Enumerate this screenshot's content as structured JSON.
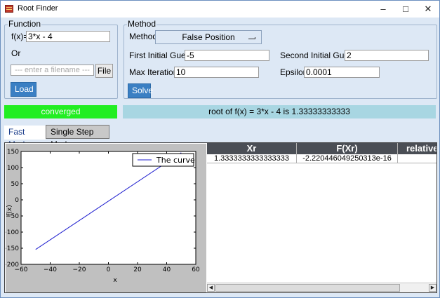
{
  "window": {
    "title": "Root Finder",
    "minimize": "–",
    "maximize": "□",
    "close": "✕"
  },
  "function_group": {
    "title": "Function",
    "fx_label": "f(x)=",
    "fx_value": "3*x - 4",
    "or_label": "Or",
    "filename_placeholder": "--- enter a filename ---",
    "file_button": "File",
    "load_button": "Load"
  },
  "method_group": {
    "title": "Method",
    "method_label": "Method",
    "method_value": "False Position",
    "first_guess_label": "First Initial Guess",
    "first_guess_value": "-5",
    "second_guess_label": "Second Initial Guess",
    "second_guess_value": "2",
    "max_iter_label": "Max Iterations",
    "max_iter_value": "10",
    "epsilon_label": "Epsilon",
    "epsilon_value": "0.0001",
    "solve_button": "Solve"
  },
  "status": {
    "state": "converged",
    "result": "root of f(x) = 3*x - 4 is 1.33333333333"
  },
  "tabs": [
    {
      "label": "Fast Mode"
    },
    {
      "label": "Single Step Mode"
    }
  ],
  "table": {
    "columns": [
      "Xr",
      "F(Xr)",
      "relative"
    ],
    "rows": [
      [
        "1.3333333333333333",
        "-2.220446049250313e-16",
        ""
      ]
    ]
  },
  "colors": {
    "converged": "#22ee22",
    "result_bg": "#a8d6e2",
    "curve": "#1f1fcf"
  },
  "chart_data": {
    "type": "line",
    "xlabel": "x",
    "ylabel": "f(x)",
    "xlim": [
      -60,
      60
    ],
    "ylim": [
      -200,
      150
    ],
    "xticks": [
      -60,
      -40,
      -20,
      0,
      20,
      40,
      60
    ],
    "yticks": [
      -200,
      -150,
      -100,
      -50,
      0,
      50,
      100,
      150
    ],
    "series": [
      {
        "name": "The curve",
        "x": [
          -50,
          50
        ],
        "y": [
          -154,
          146
        ]
      }
    ],
    "legend": "top-right",
    "grid": false
  }
}
